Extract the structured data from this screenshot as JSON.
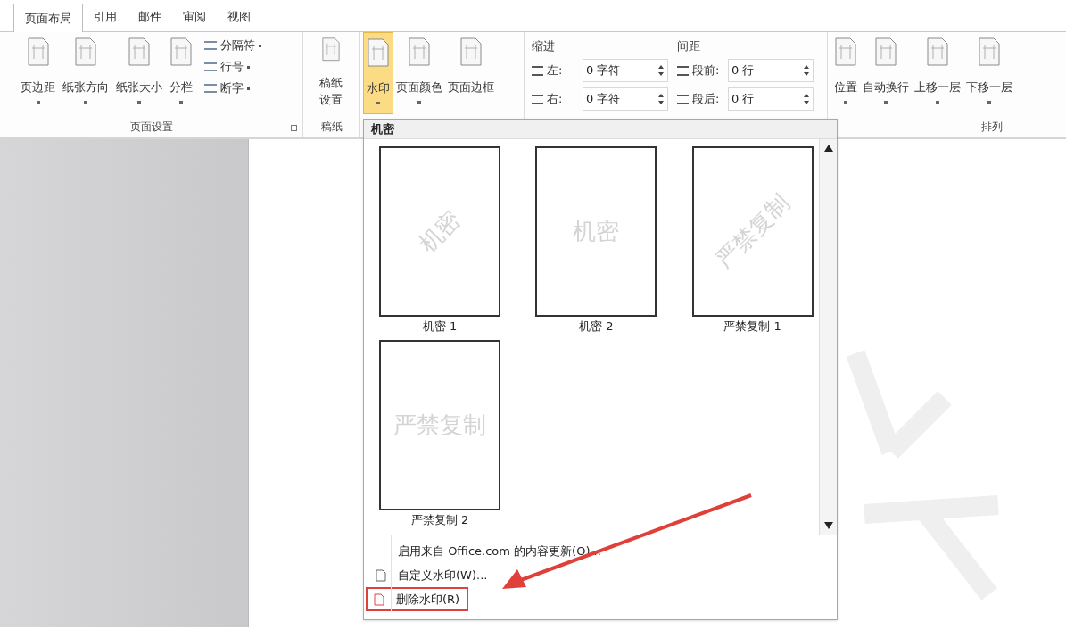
{
  "ribbon": {
    "tabs": [
      {
        "label": "页面布局",
        "selected": true
      },
      {
        "label": "引用",
        "selected": false
      },
      {
        "label": "邮件",
        "selected": false
      },
      {
        "label": "审阅",
        "selected": false
      },
      {
        "label": "视图",
        "selected": false
      }
    ],
    "page_setup": {
      "label": "页面设置",
      "large_buttons": [
        {
          "label": "页边距",
          "dropdown": true
        },
        {
          "label": "纸张方向",
          "dropdown": true
        },
        {
          "label": "纸张大小",
          "dropdown": true
        },
        {
          "label": "分栏",
          "dropdown": true
        }
      ],
      "small_buttons": [
        {
          "label": "分隔符",
          "dropdown": true
        },
        {
          "label": "行号",
          "dropdown": true
        },
        {
          "label": "断字",
          "dropdown": true
        }
      ]
    },
    "manuscript": {
      "label": "稿纸",
      "button": "稿纸设置"
    },
    "page_background": {
      "buttons": [
        {
          "label": "水印",
          "dropdown": true,
          "selected": true
        },
        {
          "label": "页面颜色",
          "dropdown": true,
          "selected": false
        },
        {
          "label": "页面边框",
          "dropdown": false,
          "selected": false
        }
      ]
    },
    "paragraph": {
      "indent": {
        "title": "缩进",
        "fields": [
          {
            "label": "左:",
            "value": "0 字符"
          },
          {
            "label": "右:",
            "value": "0 字符"
          }
        ]
      },
      "spacing": {
        "title": "间距",
        "fields": [
          {
            "label": "段前:",
            "value": "0 行"
          },
          {
            "label": "段后:",
            "value": "0 行"
          }
        ]
      }
    },
    "arrange": {
      "label": "排列",
      "buttons": [
        {
          "label": "位置",
          "dropdown": true
        },
        {
          "label": "自动换行",
          "dropdown": true
        },
        {
          "label": "上移一层",
          "dropdown": true
        },
        {
          "label": "下移一层",
          "dropdown": true
        }
      ]
    }
  },
  "watermark_menu": {
    "section": "机密",
    "gallery": [
      {
        "name": "机密 1",
        "watermark_text": "机密",
        "kind": "diagonal"
      },
      {
        "name": "机密 2",
        "watermark_text": "机密",
        "kind": "horizontal"
      },
      {
        "name": "严禁复制 1",
        "watermark_text": "严禁复制",
        "kind": "diagonal"
      },
      {
        "name": "严禁复制 2",
        "watermark_text": "严禁复制",
        "kind": "horizontal"
      }
    ],
    "items": [
      {
        "label": "启用来自 Office.com 的内容更新(O)...",
        "icon": false,
        "highlighted": false
      },
      {
        "label": "自定义水印(W)...",
        "icon": true,
        "highlighted": false
      },
      {
        "label": "删除水印(R)",
        "icon": true,
        "highlighted": true
      }
    ]
  }
}
